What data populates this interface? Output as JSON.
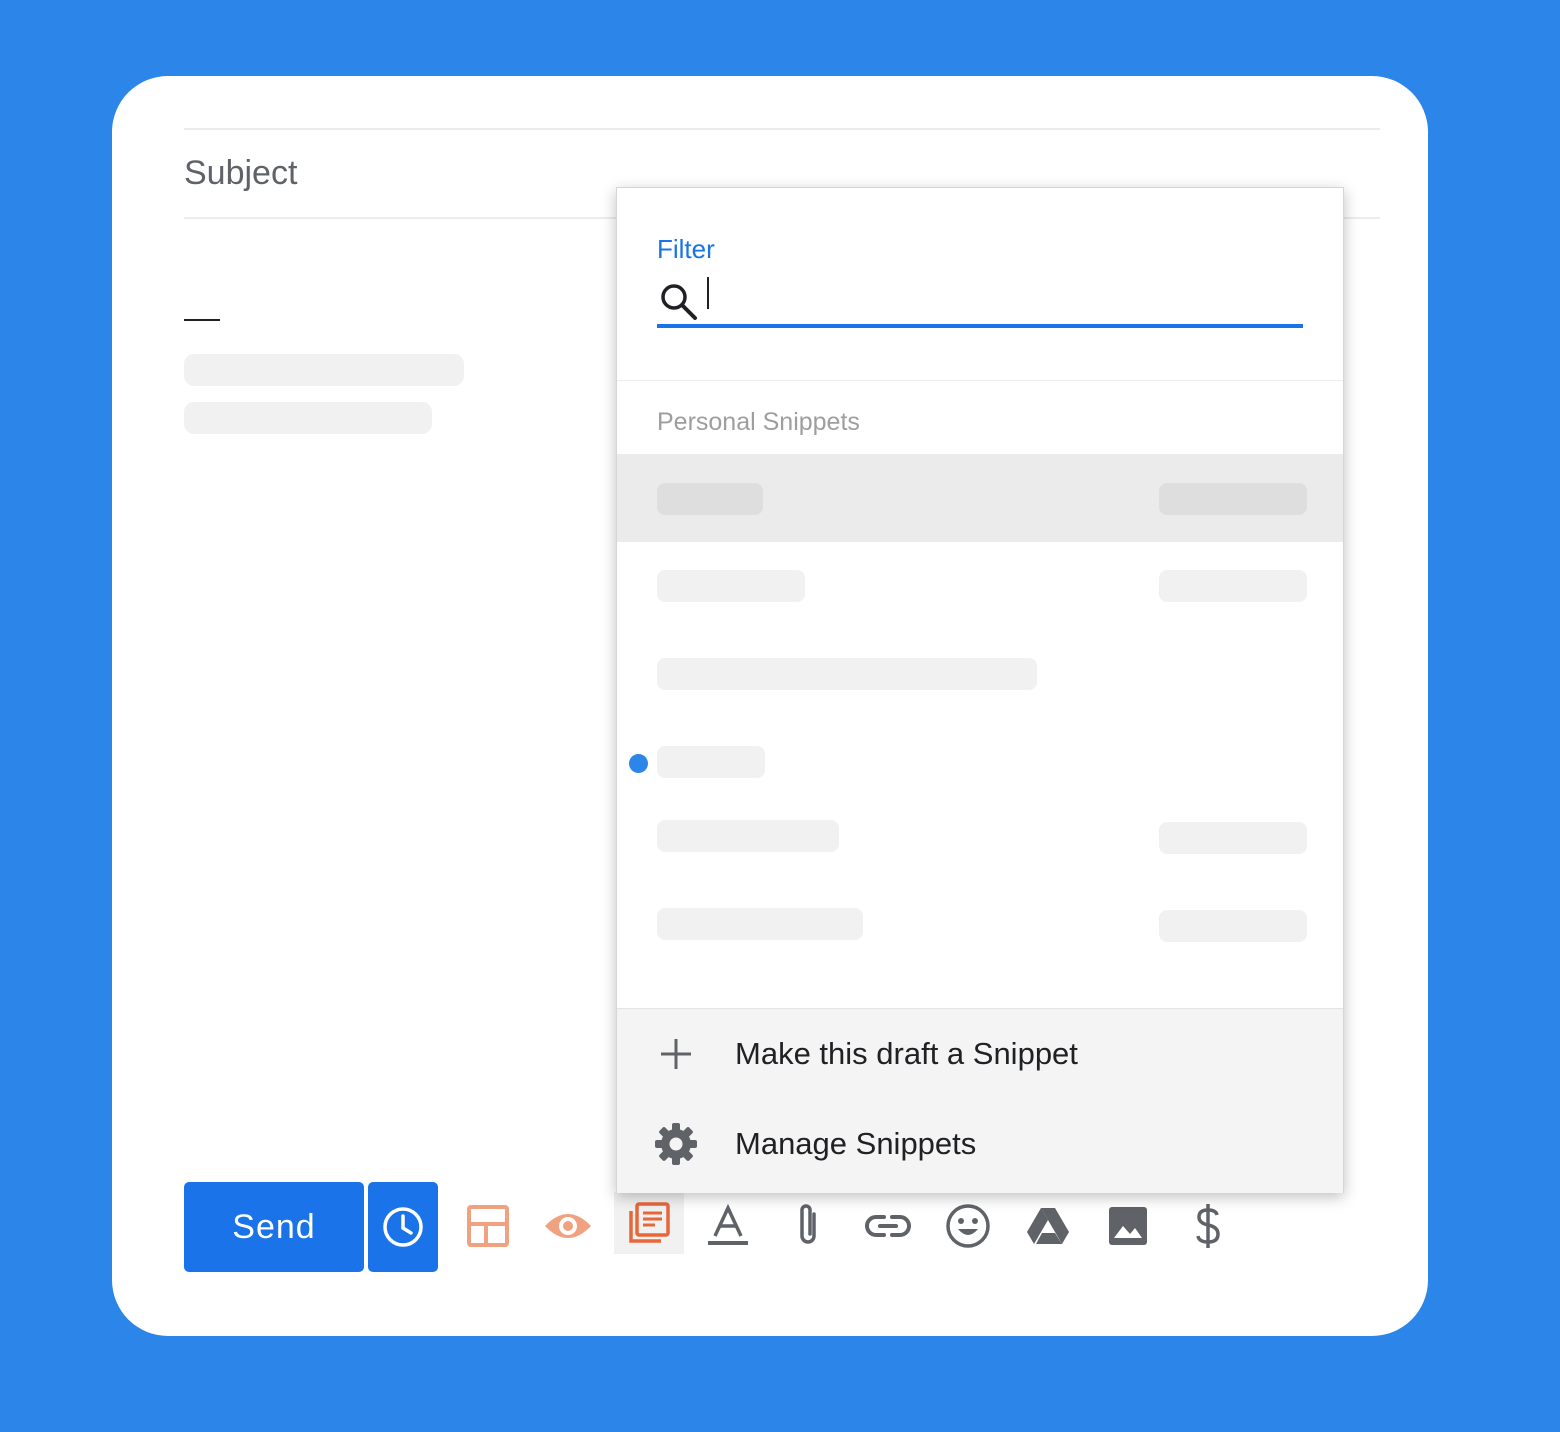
{
  "compose": {
    "subject_placeholder": "Subject"
  },
  "toolbar": {
    "send_label": "Send",
    "tools": [
      "schedule-send-icon",
      "templates-layout-icon",
      "tracking-eye-icon",
      "snippets-icon",
      "formatting-icon",
      "attach-icon",
      "link-icon",
      "emoji-icon",
      "drive-icon",
      "photo-icon",
      "payment-dollar-icon"
    ]
  },
  "snippets_menu": {
    "filter_label": "Filter",
    "filter_value": "",
    "section_title": "Personal Snippets",
    "footer": {
      "make_snippet_label": "Make this draft a Snippet",
      "manage_label": "Manage Snippets"
    }
  },
  "colors": {
    "background": "#2c85e8",
    "accent": "#1a73e8",
    "highlight": "#ebebeb",
    "orange_icon": "#f0a17f",
    "active_icon": "#e8673a"
  }
}
